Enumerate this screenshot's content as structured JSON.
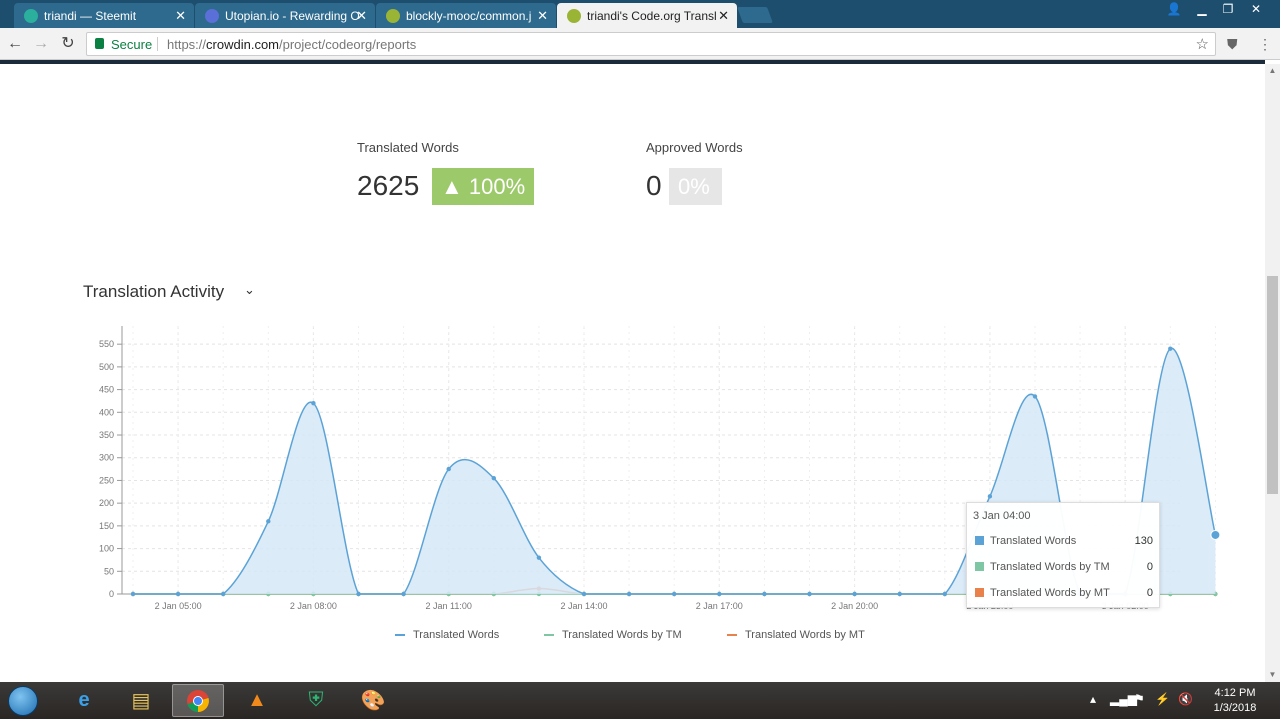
{
  "browser": {
    "tabs": [
      {
        "title": "triandi — Steemit",
        "favicon_color": "#2ab09c"
      },
      {
        "title": "Utopian.io - Rewarding O",
        "favicon_color": "#5b6fd8"
      },
      {
        "title": "blockly-mooc/common.j",
        "favicon_color": "#9ab535"
      },
      {
        "title": "triandi's Code.org Transl",
        "favicon_color": "#9ab535"
      }
    ],
    "active_tab": 3,
    "address": {
      "secure_label": "Secure",
      "scheme": "https://",
      "host": "crowdin.com",
      "path": "/project/codeorg/reports"
    }
  },
  "stats": {
    "translated": {
      "label": "Translated Words",
      "value": "2625",
      "badge": "▲ 100%",
      "badge_color": "#9cc96a"
    },
    "approved": {
      "label": "Approved Words",
      "value": "0",
      "badge": "0%",
      "badge_color": "#e6e6e6"
    }
  },
  "section": {
    "title": "Translation Activity"
  },
  "chart_data": {
    "type": "area",
    "y_ticks": [
      "0",
      "50",
      "100",
      "150",
      "200",
      "250",
      "300",
      "350",
      "400",
      "450",
      "500",
      "550"
    ],
    "ylim": [
      0,
      590
    ],
    "x_labels": [
      "2 Jan 05:00",
      "2 Jan 08:00",
      "2 Jan 11:00",
      "2 Jan 14:00",
      "2 Jan 17:00",
      "2 Jan 20:00",
      "2 Jan 23:00",
      "3 Jan 02:00"
    ],
    "x": [
      "2 Jan 04:00",
      "2 Jan 05:00",
      "2 Jan 06:00",
      "2 Jan 07:00",
      "2 Jan 08:00",
      "2 Jan 09:00",
      "2 Jan 10:00",
      "2 Jan 11:00",
      "2 Jan 12:00",
      "2 Jan 13:00",
      "2 Jan 14:00",
      "2 Jan 15:00",
      "2 Jan 16:00",
      "2 Jan 17:00",
      "2 Jan 18:00",
      "2 Jan 19:00",
      "2 Jan 20:00",
      "2 Jan 21:00",
      "2 Jan 22:00",
      "2 Jan 23:00",
      "3 Jan 00:00",
      "3 Jan 01:00",
      "3 Jan 02:00",
      "3 Jan 03:00",
      "3 Jan 04:00"
    ],
    "grid": true,
    "series": [
      {
        "name": "Translated Words",
        "color": "#5ba3d6",
        "values": [
          0,
          0,
          0,
          160,
          420,
          0,
          0,
          275,
          255,
          80,
          0,
          0,
          0,
          0,
          0,
          0,
          0,
          0,
          0,
          215,
          435,
          0,
          0,
          540,
          130
        ]
      },
      {
        "name": "Translated Words by TM",
        "color": "#7ec6a4",
        "values": [
          0,
          0,
          0,
          0,
          0,
          0,
          0,
          0,
          0,
          0,
          0,
          0,
          0,
          0,
          0,
          0,
          0,
          0,
          0,
          0,
          0,
          0,
          0,
          0,
          0
        ]
      },
      {
        "name": "Translated Words by MT",
        "color": "#e8824a",
        "values": [
          0,
          0,
          0,
          0,
          0,
          0,
          0,
          0,
          0,
          12,
          0,
          0,
          0,
          0,
          0,
          0,
          0,
          0,
          0,
          0,
          0,
          0,
          0,
          0,
          0
        ]
      }
    ]
  },
  "tooltip": {
    "title": "3 Jan 04:00",
    "rows": [
      {
        "label": "Translated Words",
        "value": "130",
        "color": "#5ba3d6"
      },
      {
        "label": "Translated Words by TM",
        "value": "0",
        "color": "#7ec6a4"
      },
      {
        "label": "Translated Words by MT",
        "value": "0",
        "color": "#e8824a"
      }
    ]
  },
  "taskbar": {
    "apps": [
      "internet-explorer",
      "file-explorer",
      "chrome",
      "vlc",
      "shield-app",
      "paint"
    ],
    "active_app": "chrome",
    "clock_time": "4:12 PM",
    "clock_date": "1/3/2018"
  }
}
